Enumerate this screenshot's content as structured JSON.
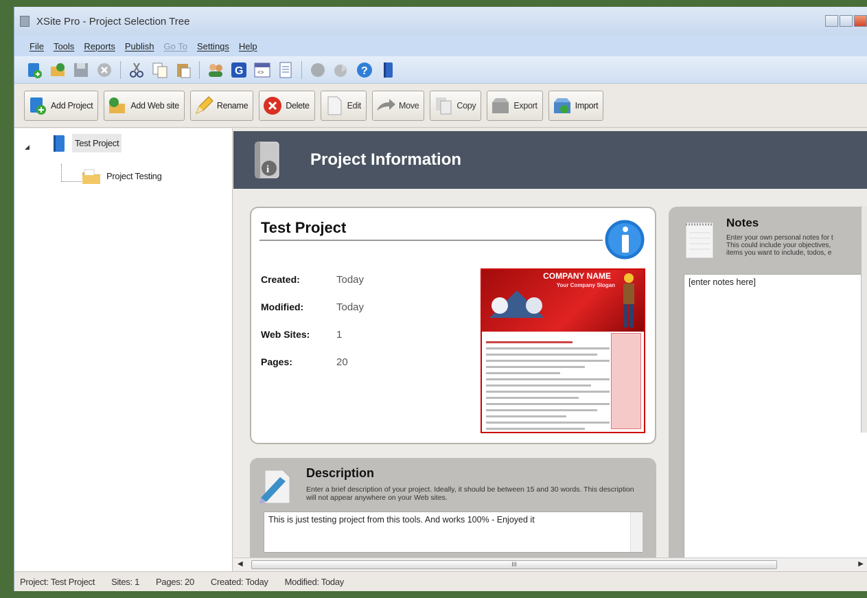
{
  "window": {
    "title": "XSite Pro - Project Selection Tree"
  },
  "menu": [
    {
      "label": "File",
      "enabled": true
    },
    {
      "label": "Tools",
      "enabled": true
    },
    {
      "label": "Reports",
      "enabled": true
    },
    {
      "label": "Publish",
      "enabled": true
    },
    {
      "label": "Go To",
      "enabled": false
    },
    {
      "label": "Settings",
      "enabled": true
    },
    {
      "label": "Help",
      "enabled": true
    }
  ],
  "toolbar_icons": [
    "add-project-icon",
    "add-website-icon",
    "save-icon",
    "delete-icon",
    "cut-icon",
    "copy-icon",
    "paste-icon",
    "users-icon",
    "g-icon",
    "html-icon",
    "document-icon",
    "globe-icon",
    "publish-icon",
    "help-icon",
    "book-icon"
  ],
  "buttons": {
    "add_project": "Add Project",
    "add_website": "Add Web site",
    "rename": "Rename",
    "delete": "Delete",
    "edit": "Edit",
    "move": "Move",
    "copy": "Copy",
    "export": "Export",
    "import": "Import"
  },
  "tree": {
    "root": "Test Project",
    "child": "Project Testing"
  },
  "banner": {
    "title": "Project Information"
  },
  "project": {
    "name": "Test Project",
    "fields": {
      "created_label": "Created:",
      "created_value": "Today",
      "modified_label": "Modified:",
      "modified_value": "Today",
      "websites_label": "Web Sites:",
      "websites_value": "1",
      "pages_label": "Pages:",
      "pages_value": "20"
    },
    "thumbnail": {
      "company": "COMPANY NAME",
      "slogan": "Your Company Slogan"
    }
  },
  "description": {
    "title": "Description",
    "help": "Enter a brief description of your project. Ideally, it should be between 15 and 30 words. This description will not appear anywhere on your Web sites.",
    "value": "This is just testing project from this tools. And works 100% - Enjoyed it"
  },
  "notes": {
    "title": "Notes",
    "help_lines": [
      "Enter your own personal notes for t",
      "This could include your objectives,",
      "items you want to include, todos, e"
    ],
    "value": "[enter notes here]"
  },
  "scrollbar": {
    "grip": "III"
  },
  "status": {
    "project": "Project: Test Project",
    "sites": "Sites: 1",
    "pages": "Pages: 20",
    "created": "Created: Today",
    "modified": "Modified: Today"
  },
  "colors": {
    "banner": "#4b5462",
    "menubar": "#c9dcf4",
    "panel": "#c0bebb"
  }
}
